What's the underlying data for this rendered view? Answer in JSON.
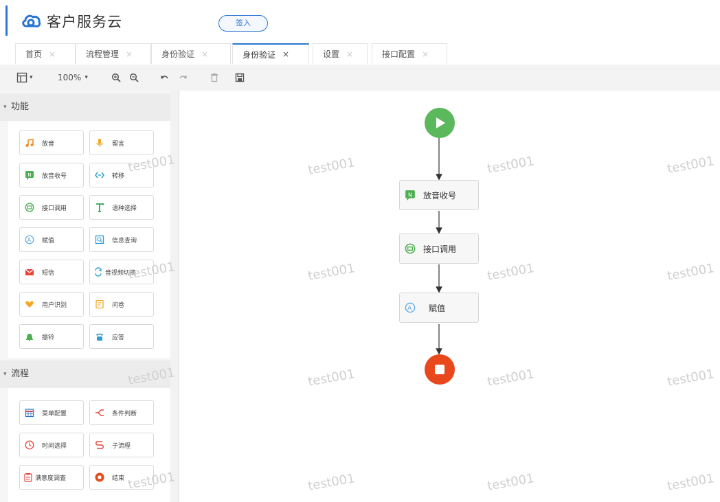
{
  "header": {
    "app_title": "客户服务云",
    "sign_in_label": "签入"
  },
  "tabs": [
    {
      "label": "首页",
      "close": "×"
    },
    {
      "label": "流程管理",
      "close": "×"
    },
    {
      "label": "身份验证",
      "close": "×"
    },
    {
      "label": "身份验证",
      "close": "×",
      "active": true
    },
    {
      "label": "设置",
      "close": "×"
    },
    {
      "label": "接口配置",
      "close": "×"
    }
  ],
  "toolbar": {
    "layout_menu": "layout-icon",
    "zoom_value": "100%",
    "zoom_caret": "▾",
    "icons": [
      "zoom-in-icon",
      "zoom-out-icon",
      "undo-icon",
      "redo-icon",
      "delete-icon",
      "save-icon"
    ]
  },
  "sidebar": {
    "function_section": "功能",
    "function_items": [
      {
        "label": "放音",
        "icon": "music-note-icon",
        "color": "#f08a24"
      },
      {
        "label": "留言",
        "icon": "microphone-icon",
        "color": "#f5a623"
      },
      {
        "label": "放音收号",
        "icon": "message-n-icon",
        "color": "#4caf50"
      },
      {
        "label": "转移",
        "icon": "transfer-icon",
        "color": "#2a9fd6"
      },
      {
        "label": "接口调用",
        "icon": "interface-icon",
        "color": "#4caf50"
      },
      {
        "label": "语种选择",
        "icon": "text-t-icon",
        "color": "#3aa35a"
      },
      {
        "label": "赋值",
        "icon": "assign-icon",
        "color": "#5aa9e6"
      },
      {
        "label": "信息查询",
        "icon": "query-icon",
        "color": "#2a9fd6"
      },
      {
        "label": "短信",
        "icon": "sms-icon",
        "color": "#e8453c"
      },
      {
        "label": "音视频切换",
        "icon": "av-switch-icon",
        "color": "#2a9fd6"
      },
      {
        "label": "用户识别",
        "icon": "heart-icon",
        "color": "#f5a623"
      },
      {
        "label": "问卷",
        "icon": "questionnaire-icon",
        "color": "#f5a623"
      },
      {
        "label": "振铃",
        "icon": "bell-icon",
        "color": "#4caf50"
      },
      {
        "label": "应答",
        "icon": "phone-icon",
        "color": "#2a9fd6"
      }
    ],
    "flow_section": "流程",
    "flow_items": [
      {
        "label": "菜单配置",
        "icon": "calendar-grid-icon",
        "color": "#2a76d2"
      },
      {
        "label": "条件判断",
        "icon": "branch-icon",
        "color": "#e8453c"
      },
      {
        "label": "时间选择",
        "icon": "clock-icon",
        "color": "#e8453c"
      },
      {
        "label": "子流程",
        "icon": "subflow-icon",
        "color": "#e8453c"
      },
      {
        "label": "满意度调查",
        "icon": "survey-icon",
        "color": "#e8453c"
      },
      {
        "label": "结束",
        "icon": "stop-circle-icon",
        "color": "#e84a1c"
      }
    ]
  },
  "canvas": {
    "watermark": "test001",
    "nodes": [
      {
        "label": "放音收号",
        "icon": "message-n-icon"
      },
      {
        "label": "接口调用",
        "icon": "interface-icon"
      },
      {
        "label": "赋值",
        "icon": "assign-icon"
      }
    ],
    "start_icon": "play-icon",
    "end_icon": "stop-icon",
    "start_color": "#5cb85c",
    "end_color": "#e8481c"
  }
}
